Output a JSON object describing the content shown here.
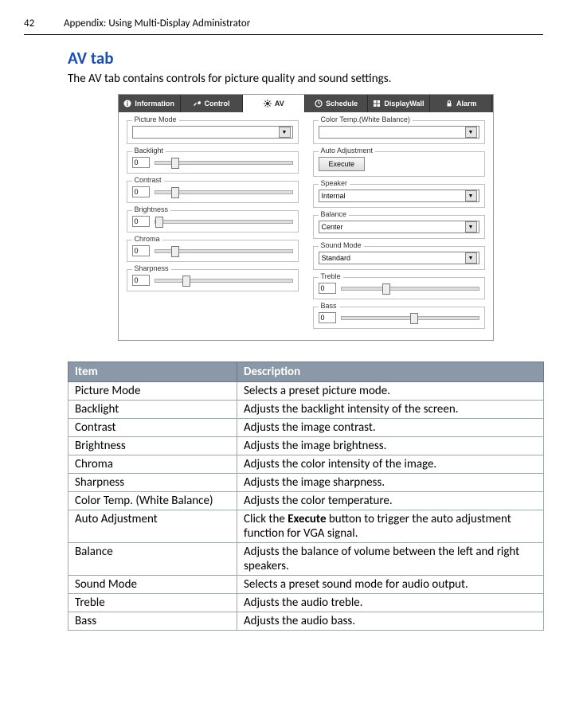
{
  "header": {
    "page_number": "42",
    "title": "Appendix: Using Multi-Display Administrator"
  },
  "section": {
    "title": "AV tab",
    "intro": "The AV tab contains controls for picture quality and sound settings."
  },
  "tabs": {
    "information": "Information",
    "control": "Control",
    "av": "AV",
    "schedule": "Schedule",
    "displaywall": "DisplayWall",
    "alarm": "Alarm"
  },
  "panel": {
    "left": {
      "picture_mode": {
        "label": "Picture Mode",
        "value": ""
      },
      "backlight": {
        "label": "Backlight",
        "value": "0",
        "thumb_pct": 12
      },
      "contrast": {
        "label": "Contrast",
        "value": "0",
        "thumb_pct": 12
      },
      "brightness": {
        "label": "Brightness",
        "value": "0",
        "thumb_pct": 0
      },
      "chroma": {
        "label": "Chroma",
        "value": "0",
        "thumb_pct": 12
      },
      "sharpness": {
        "label": "Sharpness",
        "value": "0",
        "thumb_pct": 20
      }
    },
    "right": {
      "color_temp": {
        "label": "Color Temp.(White Balance)",
        "value": ""
      },
      "auto_adjustment": {
        "label": "Auto Adjustment",
        "button": "Execute"
      },
      "speaker": {
        "label": "Speaker",
        "value": "Internal"
      },
      "balance": {
        "label": "Balance",
        "value": "Center"
      },
      "sound_mode": {
        "label": "Sound Mode",
        "value": "Standard"
      },
      "treble": {
        "label": "Treble",
        "value": "0",
        "thumb_pct": 30
      },
      "bass": {
        "label": "Bass",
        "value": "0",
        "thumb_pct": 50
      }
    }
  },
  "table": {
    "head_item": "Item",
    "head_desc": "Description",
    "rows": [
      {
        "item": "Picture Mode",
        "desc": "Selects a preset picture mode."
      },
      {
        "item": "Backlight",
        "desc": "Adjusts the backlight intensity of the screen."
      },
      {
        "item": "Contrast",
        "desc": "Adjusts the image contrast."
      },
      {
        "item": "Brightness",
        "desc": "Adjusts the image brightness."
      },
      {
        "item": "Chroma",
        "desc": "Adjusts the color intensity of the image."
      },
      {
        "item": "Sharpness",
        "desc": "Adjusts the image sharpness."
      },
      {
        "item": "Color Temp. (White Balance)",
        "desc": "Adjusts the color temperature."
      },
      {
        "item": "Auto Adjustment",
        "desc_pre": "Click the ",
        "desc_bold": "Execute",
        "desc_post": " button to trigger the auto adjustment function for VGA signal."
      },
      {
        "item": "Balance",
        "desc": "Adjusts the balance of volume between the left and right speakers."
      },
      {
        "item": "Sound Mode",
        "desc": "Selects a preset sound mode for audio output."
      },
      {
        "item": "Treble",
        "desc": "Adjusts the audio treble."
      },
      {
        "item": "Bass",
        "desc": "Adjusts the audio bass."
      }
    ]
  }
}
